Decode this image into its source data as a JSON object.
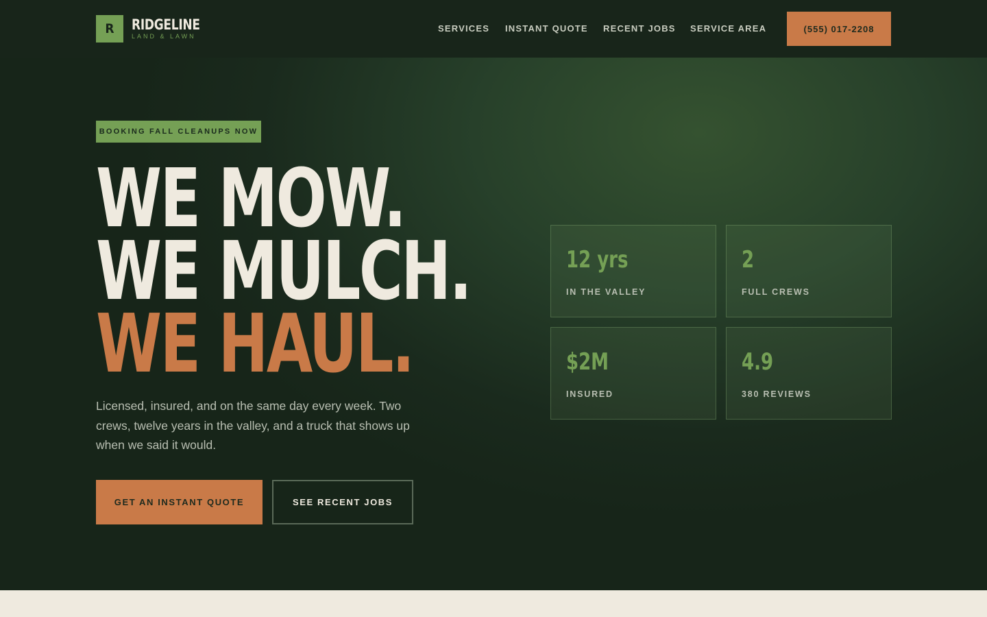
{
  "brand": {
    "mark": "R",
    "name": "RIDGELINE",
    "tagline": "LAND & LAWN"
  },
  "nav": {
    "links": [
      "SERVICES",
      "INSTANT QUOTE",
      "RECENT JOBS",
      "SERVICE AREA"
    ],
    "phone": "(555) 017-2208"
  },
  "hero": {
    "badge": "BOOKING FALL CLEANUPS NOW",
    "headline": [
      "WE MOW.",
      "WE MULCH.",
      "WE HAUL."
    ],
    "lede": "Licensed, insured, and on the same day every week. Two crews, twelve years in the valley, and a truck that shows up when we said it would.",
    "primary_cta": "GET AN INSTANT QUOTE",
    "secondary_cta": "SEE RECENT JOBS"
  },
  "stats": [
    {
      "value": "12 yrs",
      "label": "IN THE VALLEY"
    },
    {
      "value": "2",
      "label": "FULL CREWS"
    },
    {
      "value": "$2M",
      "label": "INSURED"
    },
    {
      "value": "4.9",
      "label": "380 REVIEWS"
    }
  ],
  "colors": {
    "nav_bg": "#18251a",
    "accent_green": "#75a055",
    "accent_orange": "#c97a48",
    "cream": "#efeadf"
  }
}
